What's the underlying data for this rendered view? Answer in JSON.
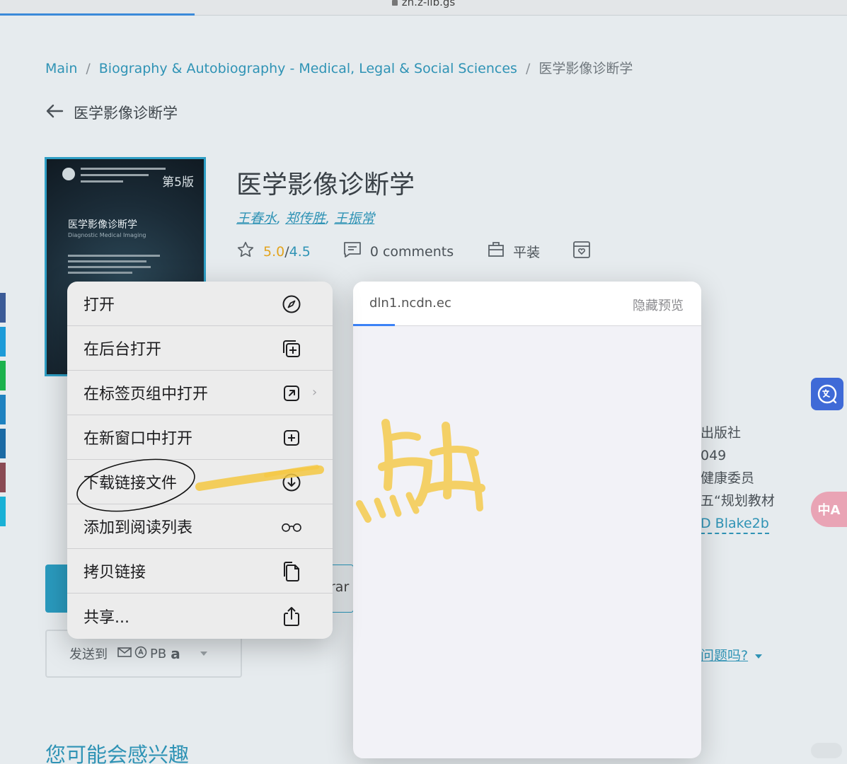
{
  "browser": {
    "url": "zh.z-lib.gs",
    "load_progress": 0.23
  },
  "breadcrumb": {
    "main": "Main",
    "category": "Biography & Autobiography - Medical, Legal & Social Sciences",
    "current": "医学影像诊断学"
  },
  "page_header": {
    "back_title": "医学影像诊断学"
  },
  "cover": {
    "title": "医学影像诊断学",
    "subtitle": "Diagnostic Medical Imaging",
    "edition": "第5版"
  },
  "book": {
    "title": "医学影像诊断学",
    "authors": [
      "王春水",
      "郑传胜",
      "王振常"
    ],
    "rating": "5.0",
    "rating_max": "4.5",
    "rating_sep": " / ",
    "comments": "0 comments",
    "binding": "平装"
  },
  "details_partial": {
    "publisher": "出版社",
    "number": "049",
    "committee": "健康委员",
    "series": "五“规划教材",
    "hash": "D Blake2b"
  },
  "problem_link": "问题吗?",
  "send_to": {
    "label": "发送到",
    "pb": "PB",
    "amazon": "a"
  },
  "download_fragment": "rar",
  "you_may_like": "您可能会感兴趣",
  "context_menu": {
    "items": [
      {
        "label": "打开",
        "icon": "compass-icon"
      },
      {
        "label": "在后台打开",
        "icon": "add-window-icon"
      },
      {
        "label": "在标签页组中打开",
        "icon": "tab-group-icon"
      },
      {
        "label": "在新窗口中打开",
        "icon": "new-window-icon"
      },
      {
        "label": "下载链接文件",
        "icon": "download-icon"
      },
      {
        "label": "添加到阅读列表",
        "icon": "glasses-icon"
      },
      {
        "label": "拷贝链接",
        "icon": "copy-icon"
      },
      {
        "label": "共享...",
        "icon": "share-icon"
      }
    ]
  },
  "preview": {
    "url": "dln1.ncdn.ec",
    "hide_label": "隐藏预览",
    "load_progress": 0.12
  },
  "annotation": {
    "handwritten_note": "点击",
    "color": "#f5c842"
  },
  "colors": {
    "accent": "#2f93b5",
    "rating": "#e3a41f",
    "translate_primary": "#3f6ad7",
    "translate_secondary": "#e9a4b5"
  }
}
